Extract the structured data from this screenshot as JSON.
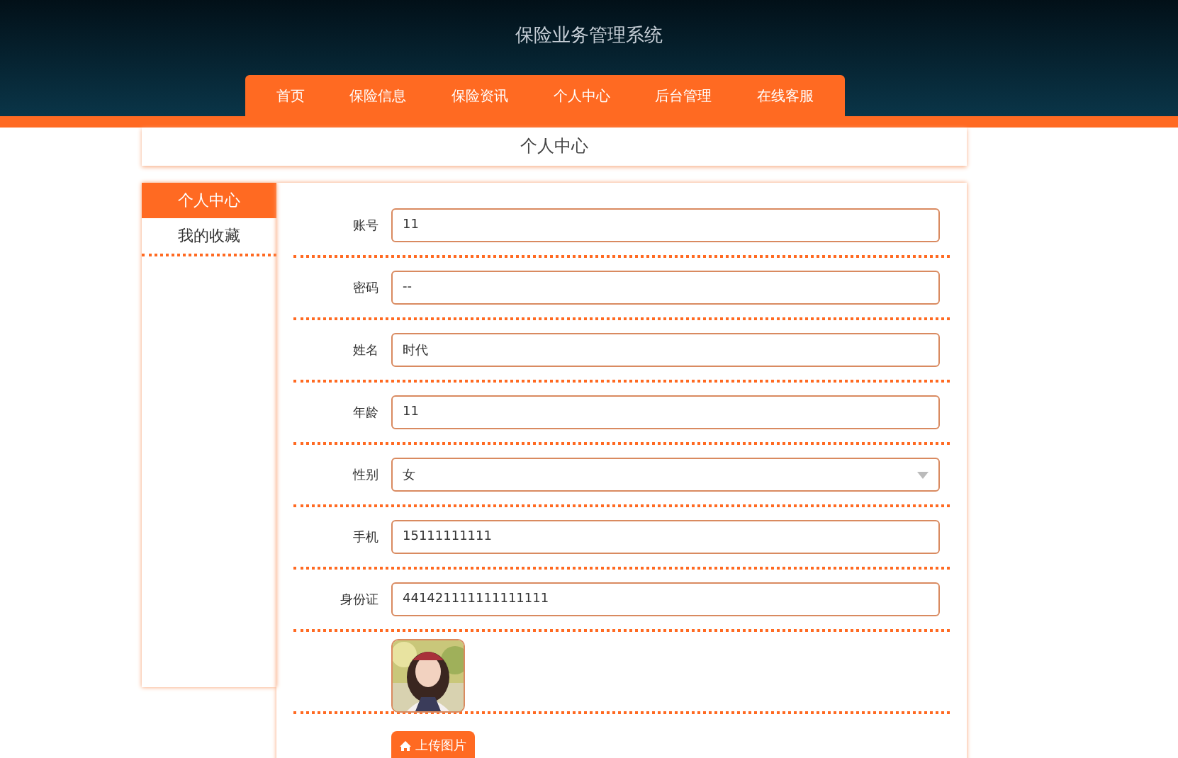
{
  "header": {
    "title": "保险业务管理系统"
  },
  "nav": [
    {
      "label": "首页",
      "selected": false
    },
    {
      "label": "保险信息",
      "selected": false
    },
    {
      "label": "保险资讯",
      "selected": false
    },
    {
      "label": "个人中心",
      "selected": false
    },
    {
      "label": "后台管理",
      "selected": false
    },
    {
      "label": "在线客服",
      "selected": false
    }
  ],
  "page_title": "个人中心",
  "sidebar": [
    {
      "label": "个人中心",
      "selected": true
    },
    {
      "label": "我的收藏",
      "selected": false
    }
  ],
  "form": [
    {
      "kind": "input",
      "label": "账号",
      "value": "11"
    },
    {
      "kind": "input",
      "label": "密码",
      "value": "--"
    },
    {
      "kind": "input",
      "label": "姓名",
      "value": "时代"
    },
    {
      "kind": "input",
      "label": "年龄",
      "value": "11"
    },
    {
      "kind": "select",
      "label": "性别",
      "value": "女"
    },
    {
      "kind": "input",
      "label": "手机",
      "value": "15111111111"
    },
    {
      "kind": "input",
      "label": "身份证",
      "value": "441421111111111111"
    }
  ],
  "upload_button": "上传图片"
}
